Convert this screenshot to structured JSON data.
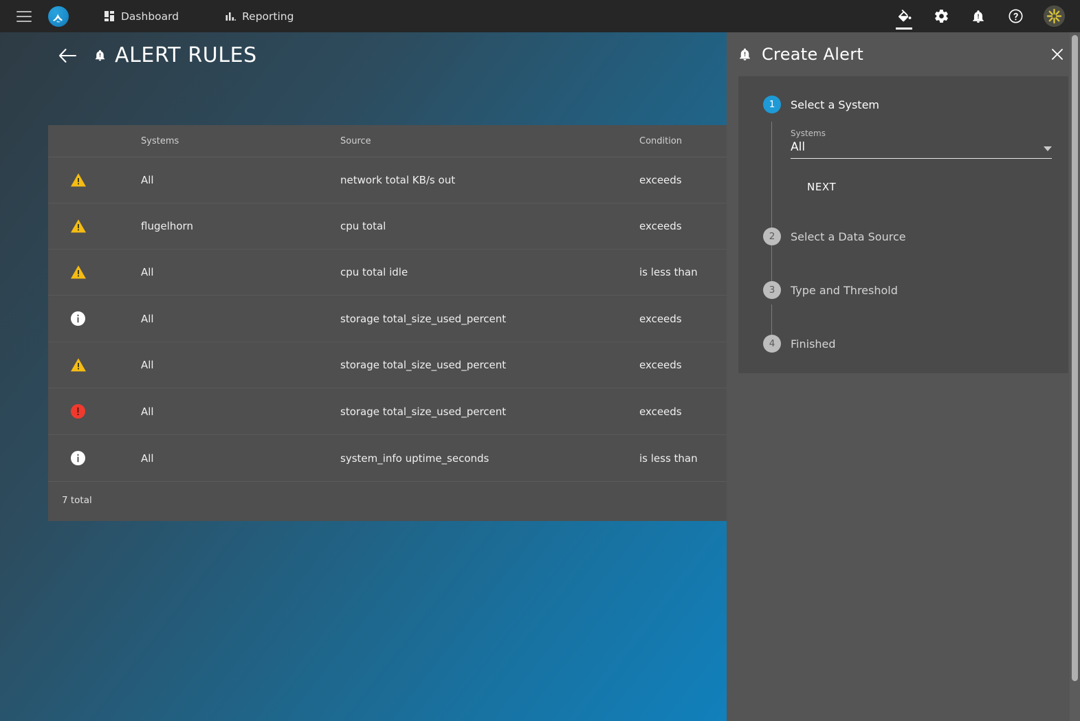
{
  "topbar": {
    "menu_icon": "hamburger-icon",
    "logo_icon": "app-logo-icon",
    "nav": [
      {
        "label": "Dashboard",
        "icon": "grid-tiles-icon"
      },
      {
        "label": "Reporting",
        "icon": "bar-chart-icon"
      }
    ],
    "actions": [
      {
        "name": "theme-paint-icon",
        "icon": "paint-bucket-icon",
        "active": true
      },
      {
        "name": "settings-icon",
        "icon": "gear-icon",
        "active": false
      },
      {
        "name": "alerts-icon",
        "icon": "bell-icon",
        "active": false
      },
      {
        "name": "help-icon",
        "icon": "question-circle-icon",
        "active": false
      }
    ],
    "avatar_icon": "user-avatar-starburst"
  },
  "page": {
    "back_icon": "arrow-left-icon",
    "title_icon": "bell-icon",
    "title": "ALERT RULES"
  },
  "table": {
    "columns": [
      "",
      "Systems",
      "Source",
      "Condition"
    ],
    "rows": [
      {
        "severity": "warning",
        "systems": "All",
        "source": "network total KB/s out",
        "condition": "exceeds"
      },
      {
        "severity": "warning",
        "systems": "flugelhorn",
        "source": "cpu total",
        "condition": "exceeds"
      },
      {
        "severity": "warning",
        "systems": "All",
        "source": "cpu total idle",
        "condition": "is less than"
      },
      {
        "severity": "info",
        "systems": "All",
        "source": "storage total_size_used_percent",
        "condition": "exceeds"
      },
      {
        "severity": "warning",
        "systems": "All",
        "source": "storage total_size_used_percent",
        "condition": "exceeds"
      },
      {
        "severity": "critical",
        "systems": "All",
        "source": "storage total_size_used_percent",
        "condition": "exceeds"
      },
      {
        "severity": "info",
        "systems": "All",
        "source": "system_info uptime_seconds",
        "condition": "is less than"
      }
    ],
    "footer": "7 total"
  },
  "drawer": {
    "icon": "bell-icon",
    "title": "Create Alert",
    "close_icon": "close-x-icon",
    "steps": [
      {
        "num": "1",
        "label": "Select a System",
        "state": "active"
      },
      {
        "num": "2",
        "label": "Select a Data Source",
        "state": "idle"
      },
      {
        "num": "3",
        "label": "Type and Threshold",
        "state": "idle"
      },
      {
        "num": "4",
        "label": "Finished",
        "state": "idle"
      }
    ],
    "system_field": {
      "label": "Systems",
      "value": "All",
      "caret_icon": "chevron-down-icon"
    },
    "next_label": "NEXT"
  },
  "colors": {
    "accent_blue": "#1e9ad6",
    "warning": "#f5bc14",
    "critical": "#f03a2e",
    "info": "#ffffff",
    "topbar_bg": "#262626",
    "panel_bg": "#555555",
    "card_bg": "#4f4f4f",
    "stepper_bg": "#4a4a4a",
    "bg_gradient_start": "#2e3b44",
    "bg_gradient_end": "#1180bc"
  },
  "scrollbar": {
    "name": "vertical-scrollbar"
  }
}
